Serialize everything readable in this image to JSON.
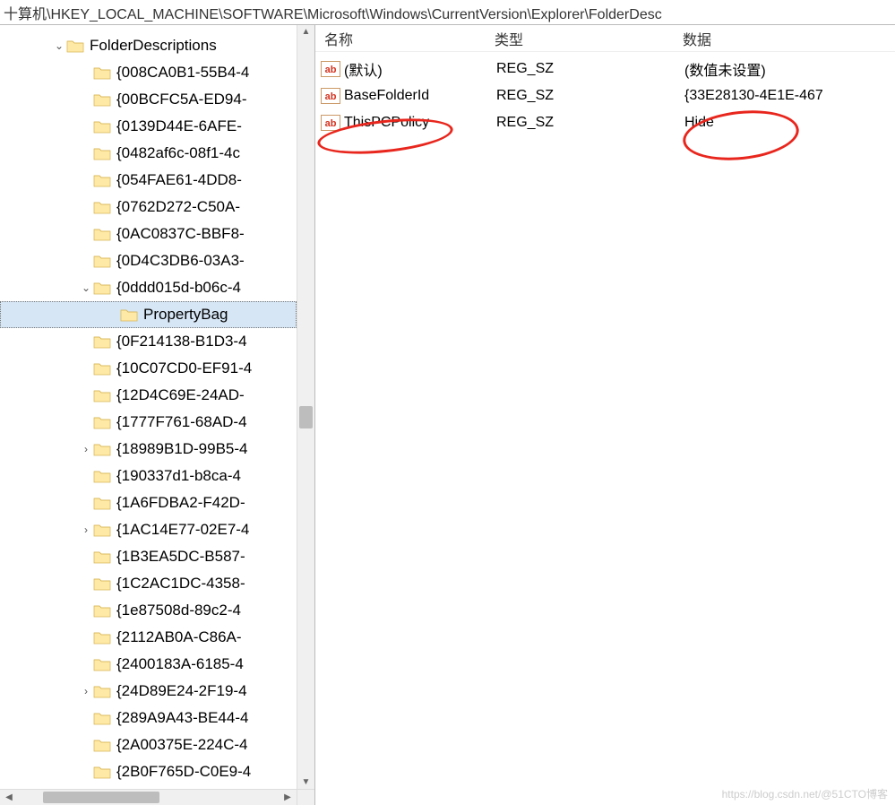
{
  "address_bar": "十算机\\HKEY_LOCAL_MACHINE\\SOFTWARE\\Microsoft\\Windows\\CurrentVersion\\Explorer\\FolderDesc",
  "tree": {
    "root_label": "FolderDescriptions",
    "items": [
      {
        "label": "{008CA0B1-55B4-4",
        "exp": "",
        "indent": 1
      },
      {
        "label": "{00BCFC5A-ED94-",
        "exp": "",
        "indent": 1
      },
      {
        "label": "{0139D44E-6AFE-",
        "exp": "",
        "indent": 1
      },
      {
        "label": "{0482af6c-08f1-4c",
        "exp": "",
        "indent": 1
      },
      {
        "label": "{054FAE61-4DD8-",
        "exp": "",
        "indent": 1
      },
      {
        "label": "{0762D272-C50A-",
        "exp": "",
        "indent": 1
      },
      {
        "label": "{0AC0837C-BBF8-",
        "exp": "",
        "indent": 1
      },
      {
        "label": "{0D4C3DB6-03A3-",
        "exp": "",
        "indent": 1
      },
      {
        "label": "{0ddd015d-b06c-4",
        "exp": "open",
        "indent": 1
      },
      {
        "label": "PropertyBag",
        "exp": "",
        "indent": 2,
        "selected": true
      },
      {
        "label": "{0F214138-B1D3-4",
        "exp": "",
        "indent": 1
      },
      {
        "label": "{10C07CD0-EF91-4",
        "exp": "",
        "indent": 1
      },
      {
        "label": "{12D4C69E-24AD-",
        "exp": "",
        "indent": 1
      },
      {
        "label": "{1777F761-68AD-4",
        "exp": "",
        "indent": 1
      },
      {
        "label": "{18989B1D-99B5-4",
        "exp": "closed",
        "indent": 1
      },
      {
        "label": "{190337d1-b8ca-4",
        "exp": "",
        "indent": 1
      },
      {
        "label": "{1A6FDBA2-F42D-",
        "exp": "",
        "indent": 1
      },
      {
        "label": "{1AC14E77-02E7-4",
        "exp": "closed",
        "indent": 1
      },
      {
        "label": "{1B3EA5DC-B587-",
        "exp": "",
        "indent": 1
      },
      {
        "label": "{1C2AC1DC-4358-",
        "exp": "",
        "indent": 1
      },
      {
        "label": "{1e87508d-89c2-4",
        "exp": "",
        "indent": 1
      },
      {
        "label": "{2112AB0A-C86A-",
        "exp": "",
        "indent": 1
      },
      {
        "label": "{2400183A-6185-4",
        "exp": "",
        "indent": 1
      },
      {
        "label": "{24D89E24-2F19-4",
        "exp": "closed",
        "indent": 1
      },
      {
        "label": "{289A9A43-BE44-4",
        "exp": "",
        "indent": 1
      },
      {
        "label": "{2A00375E-224C-4",
        "exp": "",
        "indent": 1
      },
      {
        "label": "{2B0F765D-C0E9-4",
        "exp": "",
        "indent": 1
      }
    ]
  },
  "list": {
    "headers": {
      "name": "名称",
      "type": "类型",
      "data": "数据"
    },
    "rows": [
      {
        "name": "(默认)",
        "type": "REG_SZ",
        "data": "(数值未设置)"
      },
      {
        "name": "BaseFolderId",
        "type": "REG_SZ",
        "data": "{33E28130-4E1E-467"
      },
      {
        "name": "ThisPCPolicy",
        "type": "REG_SZ",
        "data": "Hide"
      }
    ]
  },
  "watermark": "https://blog.csdn.net/@51CTO博客"
}
